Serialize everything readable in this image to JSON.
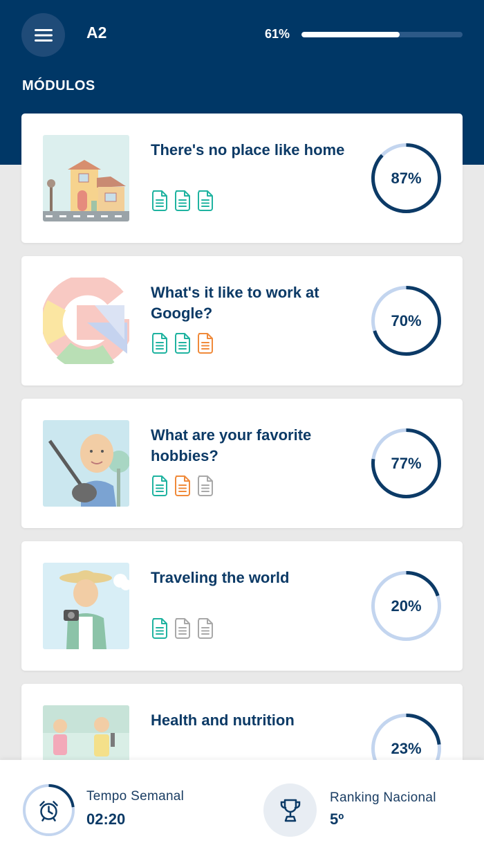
{
  "header": {
    "level": "A2",
    "progress_label": "61%",
    "progress_value": 0.61,
    "section_title": "MÓDULOS",
    "menu_icon": "hamburger-menu-icon"
  },
  "modules": [
    {
      "title": "There's no place like home",
      "percent_label": "87%",
      "percent": 0.87,
      "docs": [
        "teal",
        "teal",
        "teal"
      ],
      "thumb": "house-illustration"
    },
    {
      "title": "What's it like to work at Google?",
      "percent_label": "70%",
      "percent": 0.7,
      "docs": [
        "teal",
        "teal",
        "orange"
      ],
      "thumb": "google-g-illustration"
    },
    {
      "title": "What are your favorite hobbies?",
      "percent_label": "77%",
      "percent": 0.77,
      "docs": [
        "teal",
        "orange",
        "gray"
      ],
      "thumb": "guitar-player-illustration"
    },
    {
      "title": "Traveling the world",
      "percent_label": "20%",
      "percent": 0.2,
      "docs": [
        "teal",
        "gray",
        "gray"
      ],
      "thumb": "traveler-photographer-illustration"
    },
    {
      "title": "Health and nutrition",
      "percent_label": "23%",
      "percent": 0.23,
      "docs": [],
      "thumb": "runners-illustration"
    }
  ],
  "footer": {
    "weekly_time_label": "Tempo Semanal",
    "weekly_time_value": "02:20",
    "weekly_time_progress": 0.23,
    "ranking_label": "Ranking Nacional",
    "ranking_value": "5º"
  },
  "colors": {
    "primary": "#003766",
    "ring_dark": "#0c3a66",
    "ring_light": "#c3d5ef",
    "doc_teal": "#1fb3a0",
    "doc_orange": "#f08a3a",
    "doc_gray": "#a8a8a8"
  }
}
